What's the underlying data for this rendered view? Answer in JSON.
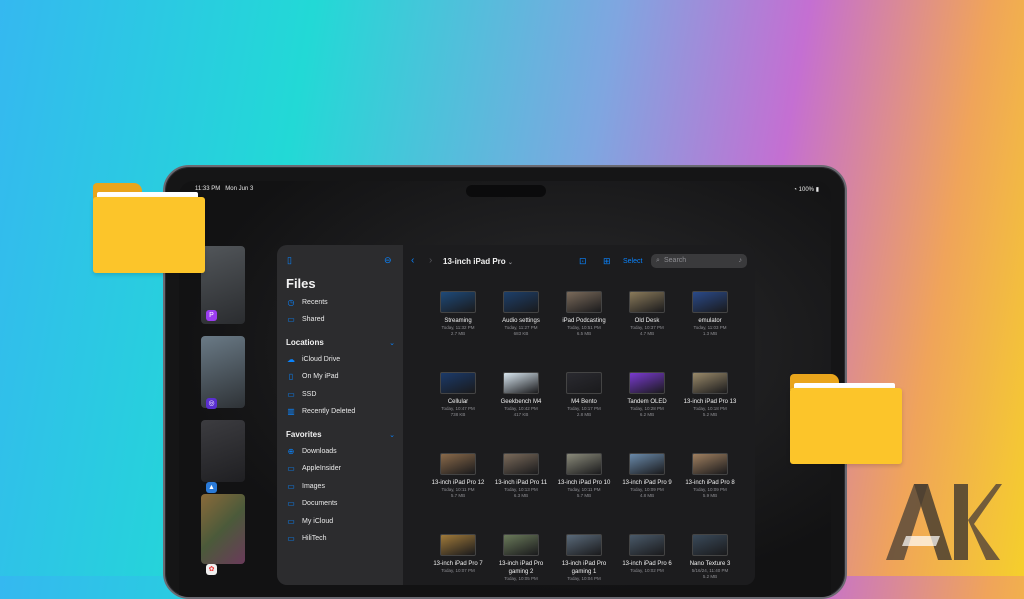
{
  "status": {
    "time": "11:33 PM",
    "date": "Mon Jun 3",
    "battery": "100%"
  },
  "files": {
    "title": "Files",
    "sidebar": {
      "items_top": [
        {
          "label": "Recents",
          "icon": "clock-icon"
        },
        {
          "label": "Shared",
          "icon": "shared-folder-icon"
        }
      ],
      "locations_label": "Locations",
      "locations": [
        {
          "label": "iCloud Drive",
          "icon": "cloud-icon"
        },
        {
          "label": "On My iPad",
          "icon": "ipad-icon"
        },
        {
          "label": "SSD",
          "icon": "drive-icon"
        },
        {
          "label": "Recently Deleted",
          "icon": "trash-icon"
        }
      ],
      "favorites_label": "Favorites",
      "favorites": [
        {
          "label": "Downloads",
          "icon": "download-icon"
        },
        {
          "label": "AppleInsider",
          "icon": "folder-icon"
        },
        {
          "label": "Images",
          "icon": "folder-icon"
        },
        {
          "label": "Documents",
          "icon": "folder-icon"
        },
        {
          "label": "My iCloud",
          "icon": "folder-icon"
        },
        {
          "label": "HiliTech",
          "icon": "folder-icon"
        }
      ]
    },
    "toolbar": {
      "title": "13-inch iPad Pro",
      "select_label": "Select",
      "search_placeholder": "Search"
    },
    "grid": [
      {
        "name": "Streaming",
        "date": "Today, 11:32 PM",
        "size": "2.7 MB",
        "color": "#1e4a7a"
      },
      {
        "name": "Audio settings",
        "date": "Today, 11:27 PM",
        "size": "683 KB",
        "color": "#1d3f6a"
      },
      {
        "name": "iPad Podcasting",
        "date": "Today, 10:51 PM",
        "size": "6.5 MB",
        "color": "#7a6a5a"
      },
      {
        "name": "Old Desk",
        "date": "Today, 10:37 PM",
        "size": "4.7 MB",
        "color": "#8a7a5a"
      },
      {
        "name": "emulator",
        "date": "Today, 11:03 PM",
        "size": "1.3 MB",
        "color": "#2a4a8a"
      },
      {
        "name": "Cellular",
        "date": "Today, 10:47 PM",
        "size": "738 KB",
        "color": "#1b3a6a"
      },
      {
        "name": "Geekbench M4",
        "date": "Today, 10:42 PM",
        "size": "417 KB",
        "color": "#d8e6f0"
      },
      {
        "name": "M4 Bento",
        "date": "Today, 10:17 PM",
        "size": "2.8 MB",
        "color": "#2a2a30"
      },
      {
        "name": "Tandem OLED",
        "date": "Today, 10:28 PM",
        "size": "6.2 MB",
        "color": "#7a3ad0"
      },
      {
        "name": "13-inch iPad Pro 13",
        "date": "Today, 10:18 PM",
        "size": "5.2 MB",
        "color": "#9a8a6a"
      },
      {
        "name": "13-inch iPad Pro 12",
        "date": "Today, 10:11 PM",
        "size": "5.7 MB",
        "color": "#8a6a4a"
      },
      {
        "name": "13-inch iPad Pro 11",
        "date": "Today, 10:13 PM",
        "size": "6.3 MB",
        "color": "#7a6a5a"
      },
      {
        "name": "13-inch iPad Pro 10",
        "date": "Today, 10:11 PM",
        "size": "5.7 MB",
        "color": "#8a8a7a"
      },
      {
        "name": "13-inch iPad Pro 9",
        "date": "Today, 10:09 PM",
        "size": "4.8 MB",
        "color": "#6a8aaa"
      },
      {
        "name": "13-inch iPad Pro 8",
        "date": "Today, 10:09 PM",
        "size": "5.9 MB",
        "color": "#a08060"
      },
      {
        "name": "13-inch iPad Pro 7",
        "date": "Today, 10:07 PM",
        "size": "",
        "color": "#a07a3a"
      },
      {
        "name": "13-inch iPad Pro gaming 2",
        "date": "Today, 10:05 PM",
        "size": "",
        "color": "#6a7a5a"
      },
      {
        "name": "13-inch iPad Pro gaming 1",
        "date": "Today, 10:04 PM",
        "size": "",
        "color": "#5a6a7a"
      },
      {
        "name": "13-inch iPad Pro 6",
        "date": "Today, 10:02 PM",
        "size": "",
        "color": "#4a5a6a"
      },
      {
        "name": "Nano Texture 3",
        "date": "5/16/24, 11:40 PM",
        "size": "5.2 MB",
        "color": "#3a4a5a"
      }
    ]
  },
  "colors": {
    "accent": "#0a84ff",
    "folder": "#fcc52a"
  }
}
